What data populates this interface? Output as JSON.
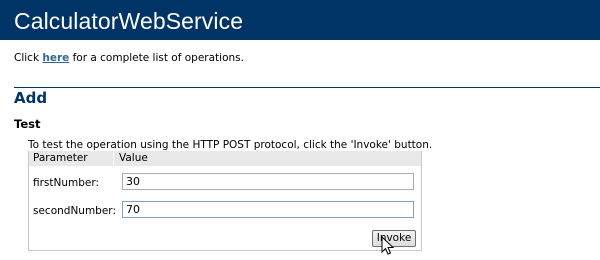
{
  "header": {
    "title": "CalculatorWebService"
  },
  "intro": {
    "prefix": "Click ",
    "link_label": "here",
    "suffix": " for a complete list of operations."
  },
  "operation": {
    "title": "Add",
    "test_heading": "Test",
    "instructions": "To test the operation using the HTTP POST protocol, click the 'Invoke' button."
  },
  "params": {
    "headers": [
      "Parameter",
      "Value"
    ],
    "rows": [
      {
        "label": "firstNumber:",
        "value": "30"
      },
      {
        "label": "secondNumber:",
        "value": "70"
      }
    ],
    "invoke_label": "Invoke"
  },
  "colors": {
    "banner": "#003366",
    "link": "#336699",
    "header_row": "#e8e8e8"
  },
  "icons": [
    "mouse-cursor-icon"
  ]
}
